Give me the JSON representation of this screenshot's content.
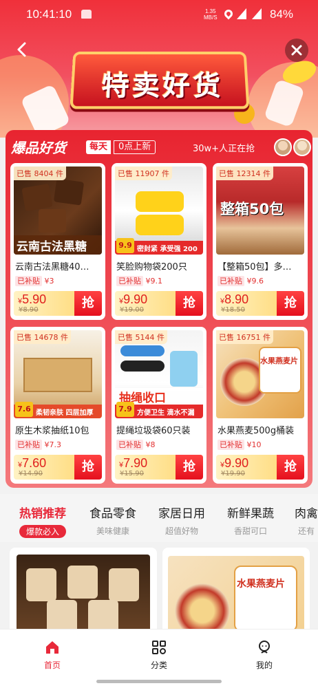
{
  "status_bar": {
    "time": "10:41:10",
    "net_speed": "1.35",
    "net_unit": "MB/S",
    "battery": "84%",
    "net_type_1": "4G",
    "net_type_2": "4G"
  },
  "header": {
    "title": "特卖好货"
  },
  "hot_section": {
    "title": "爆品好货",
    "daily_tag": "每天",
    "refresh_time": "0点上新",
    "buyers": "30w+人正在抢",
    "products": [
      {
        "sold": "已售 8404 件",
        "image_text": "云南古法黑糖",
        "name": "云南古法黑糖40…",
        "subsidy_label": "已补贴",
        "subsidy": "¥3",
        "price_symbol": "¥",
        "price": "5.90",
        "original": "¥8.90",
        "grab": "抢"
      },
      {
        "sold": "已售 11907 件",
        "image_text": "密封紧 承受强 200个",
        "name": "笑脸购物袋200只",
        "subsidy_label": "已补贴",
        "subsidy": "¥9.1",
        "price_symbol": "¥",
        "price": "9.90",
        "original": "¥19.00",
        "grab": "抢",
        "badge_price": "9.9"
      },
      {
        "sold": "已售 12314 件",
        "image_text": "整箱50包",
        "name": "【整箱50包】多…",
        "subsidy_label": "已补贴",
        "subsidy": "¥9.6",
        "price_symbol": "¥",
        "price": "8.90",
        "original": "¥18.50",
        "grab": "抢"
      },
      {
        "sold": "已售 14678 件",
        "image_text": "柔韧亲肤 四层加厚",
        "name": "原生木浆抽纸10包",
        "subsidy_label": "已补贴",
        "subsidy": "¥7.3",
        "price_symbol": "¥",
        "price": "7.60",
        "original": "¥14.90",
        "grab": "抢",
        "badge_price": "7.6"
      },
      {
        "sold": "已售 5144 件",
        "image_text": "抽绳收口",
        "image_subtext": "方便卫生 滴水不漏",
        "name": "提绳垃圾袋60只装",
        "subsidy_label": "已补贴",
        "subsidy": "¥8",
        "price_symbol": "¥",
        "price": "7.90",
        "original": "¥15.90",
        "grab": "抢",
        "badge_price": "7.9"
      },
      {
        "sold": "已售 16751 件",
        "image_text": "水果燕麦片",
        "name": "水果燕麦500g桶装",
        "subsidy_label": "已补贴",
        "subsidy": "¥10",
        "price_symbol": "¥",
        "price": "9.90",
        "original": "¥19.90",
        "grab": "抢"
      }
    ]
  },
  "category_tabs": [
    {
      "title": "热销推荐",
      "subtitle": "爆款必入",
      "active": true
    },
    {
      "title": "食品零食",
      "subtitle": "美味健康"
    },
    {
      "title": "家居日用",
      "subtitle": "超值好物"
    },
    {
      "title": "新鲜果蔬",
      "subtitle": "香甜可口"
    },
    {
      "title": "肉禽",
      "subtitle": "还有"
    }
  ],
  "feed": {
    "card2_text": "水果燕麦片"
  },
  "bottom_nav": [
    {
      "label": "首页",
      "icon": "home-icon",
      "active": true
    },
    {
      "label": "分类",
      "icon": "grid-icon"
    },
    {
      "label": "我的",
      "icon": "user-icon"
    }
  ],
  "colors": {
    "accent": "#e8293a",
    "panel": "#e82430",
    "price_bar": "#ffd56a"
  }
}
